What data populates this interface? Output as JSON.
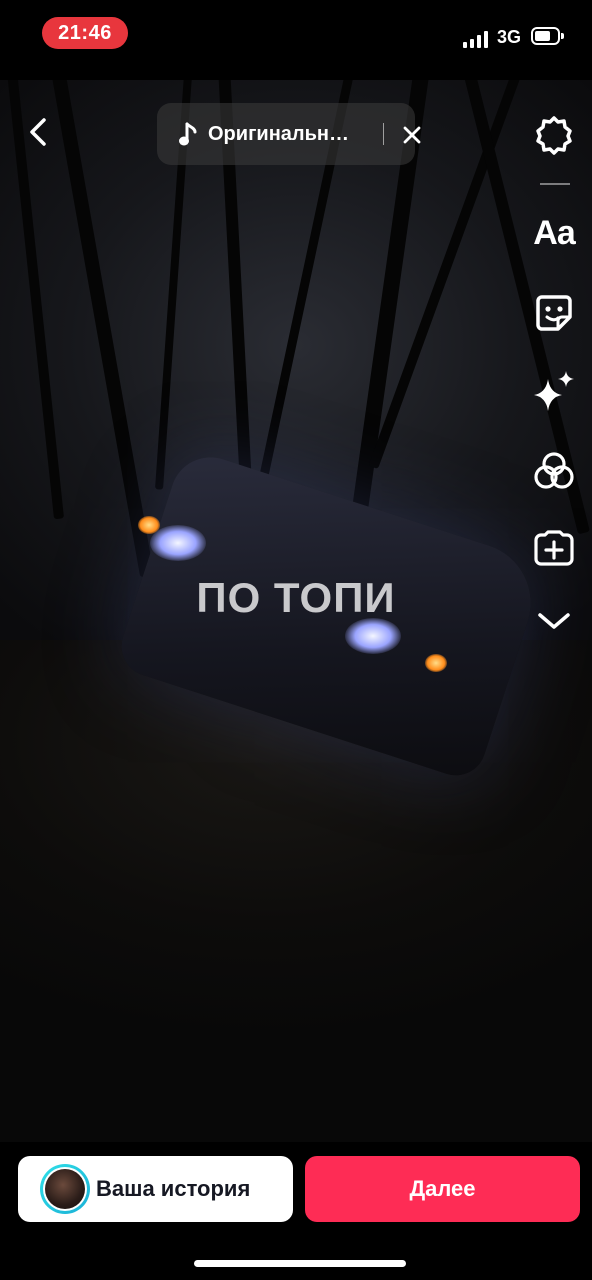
{
  "status_bar": {
    "time": "21:46",
    "network": "3G"
  },
  "editor": {
    "sound_title": "Оригинальн…",
    "caption_text": "ПО ТОПИ",
    "tools": [
      {
        "name": "settings",
        "icon": "gear-icon"
      },
      {
        "name": "text",
        "icon": "text-icon",
        "label": "Aa"
      },
      {
        "name": "stickers",
        "icon": "sticker-icon"
      },
      {
        "name": "effects",
        "icon": "sparkles-icon"
      },
      {
        "name": "filters",
        "icon": "filters-icon"
      },
      {
        "name": "add-clip",
        "icon": "add-clip-icon"
      },
      {
        "name": "more",
        "icon": "chevron-down-icon"
      }
    ]
  },
  "bottom": {
    "story_label": "Ваша история",
    "next_label": "Далее"
  },
  "colors": {
    "status_time_bg": "#e8363d",
    "primary_button": "#fe2c55",
    "avatar_ring": "#30e0e8"
  }
}
